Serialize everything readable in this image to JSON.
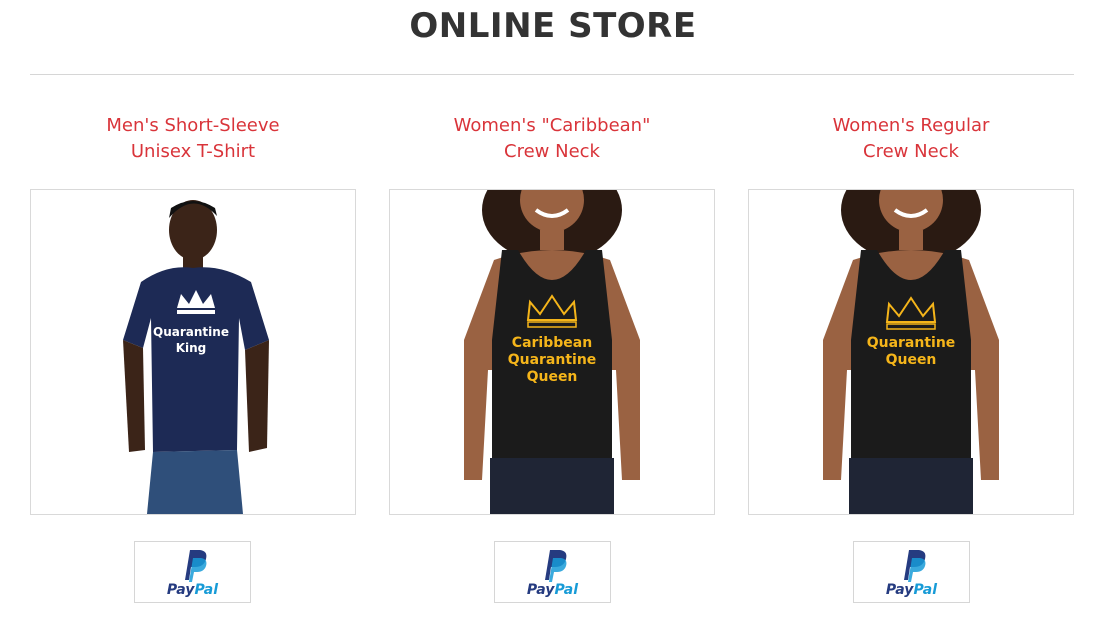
{
  "page": {
    "title": "ONLINE STORE"
  },
  "colors": {
    "title": "#333333",
    "accent": "#d9343a",
    "paypal_dark": "#253b80",
    "paypal_light": "#179bd7",
    "print_gold": "#f5b51a"
  },
  "products": [
    {
      "title_line1": "Men's Short-Sleeve",
      "title_line2": "Unisex T-Shirt",
      "shirt_print": [
        "Quarantine",
        "King"
      ],
      "shirt_color": "navy",
      "button": {
        "pay": "Pay",
        "pal": "Pal",
        "icon": "paypal-icon"
      }
    },
    {
      "title_line1": "Women's \"Caribbean\"",
      "title_line2": "Crew Neck",
      "shirt_print": [
        "Caribbean",
        "Quarantine",
        "Queen"
      ],
      "shirt_color": "black",
      "button": {
        "pay": "Pay",
        "pal": "Pal",
        "icon": "paypal-icon"
      }
    },
    {
      "title_line1": "Women's Regular",
      "title_line2": "Crew Neck",
      "shirt_print": [
        "Quarantine",
        "Queen"
      ],
      "shirt_color": "black",
      "button": {
        "pay": "Pay",
        "pal": "Pal",
        "icon": "paypal-icon"
      }
    }
  ]
}
